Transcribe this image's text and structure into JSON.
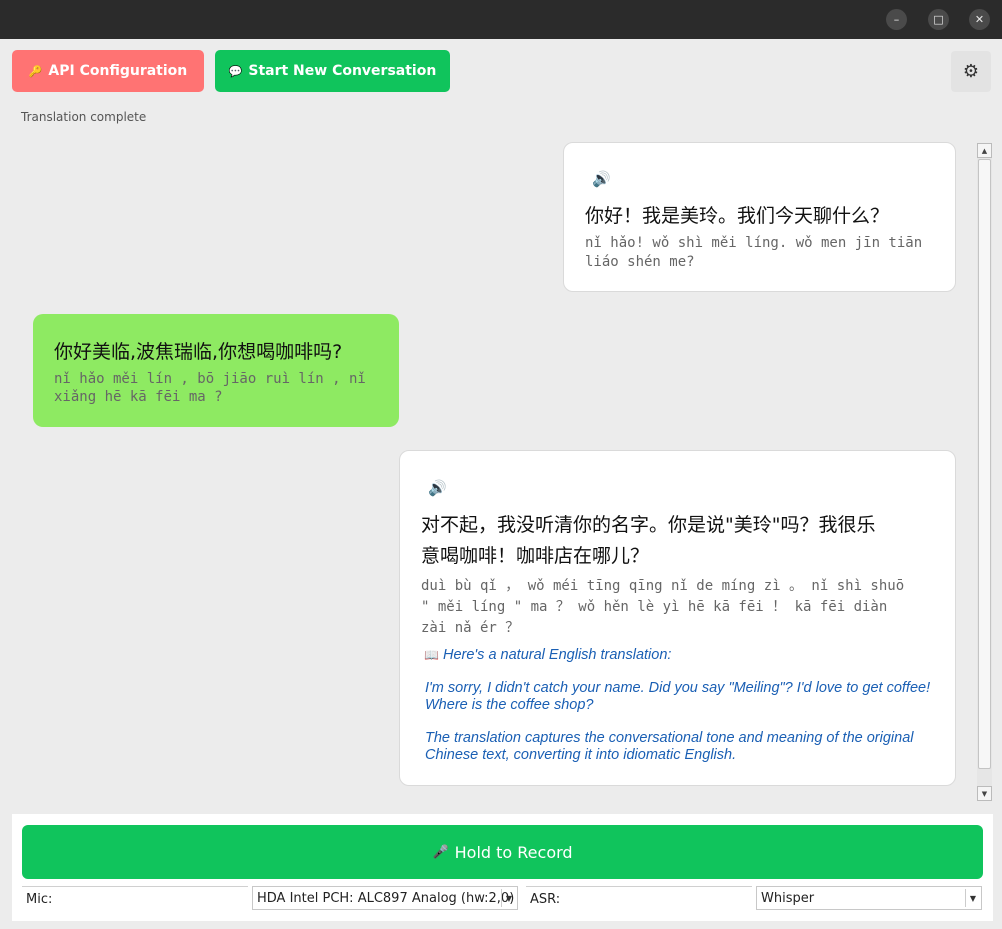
{
  "window": {
    "minimize_icon": "minimize-icon",
    "maximize_icon": "maximize-icon",
    "close_icon": "close-icon",
    "minimize_glyph": "–",
    "maximize_glyph": "□",
    "close_glyph": "✕"
  },
  "toolbar": {
    "api_icon": "🔑",
    "api_label": "API Configuration",
    "new_conv_icon": "💬",
    "new_conv_label": "Start New Conversation",
    "settings_icon": "⚙"
  },
  "status": "Translation complete",
  "messages": [
    {
      "role": "partner",
      "speaker_icon": "🔊",
      "hanzi_lines": [
        "你好！我是美玲。我们今天聊什么？"
      ],
      "pinyin_lines": [
        "nǐ hǎo! wǒ shì měi líng. wǒ men jīn tiān",
        "liáo shén me?"
      ]
    },
    {
      "role": "user",
      "hanzi_lines": [
        "你好美临,波焦瑞临,你想喝咖啡吗?"
      ],
      "pinyin_lines": [
        "nǐ hǎo měi lín , bō jiāo ruì lín , nǐ",
        "xiǎng hē kā fēi ma ?"
      ]
    },
    {
      "role": "partner",
      "speaker_icon": "🔊",
      "hanzi_lines": [
        "对不起，我没听清你的名字。你是说\"美玲\"吗？我很乐",
        "意喝咖啡！咖啡店在哪儿？"
      ],
      "pinyin_lines": [
        "duì bù qǐ ， wǒ méi tīng qīng nǐ de míng zì 。 nǐ shì shuō",
        "\" měi líng \" ma ？ wǒ hěn lè yì hē kā fēi ！ kā fēi diàn",
        "zài nǎ ér ？"
      ],
      "translation_icon": "📖",
      "translation_header": "Here's a natural English translation:",
      "translation_lines": [
        "I'm sorry, I didn't catch your name. Did you say \"Meiling\"? I'd love to get coffee!",
        "Where is the coffee shop?"
      ],
      "translation_note_lines": [
        "The translation captures the conversational tone and meaning of the original",
        "Chinese text, converting it into idiomatic English."
      ]
    }
  ],
  "scrollbar": {
    "up_glyph": "▲",
    "down_glyph": "▼"
  },
  "record": {
    "icon": "🎤",
    "label": "Hold to Record"
  },
  "controls": {
    "mic_label": "Mic:",
    "mic_value": "HDA Intel PCH: ALC897 Analog (hw:2,0)",
    "asr_label": "ASR:",
    "asr_value": "Whisper",
    "dropdown_glyph": "▼"
  },
  "colors": {
    "api_button": "#ff7373",
    "primary_green": "#10c45c",
    "user_bubble": "#8eea62",
    "translation_text": "#1a5fb4"
  }
}
